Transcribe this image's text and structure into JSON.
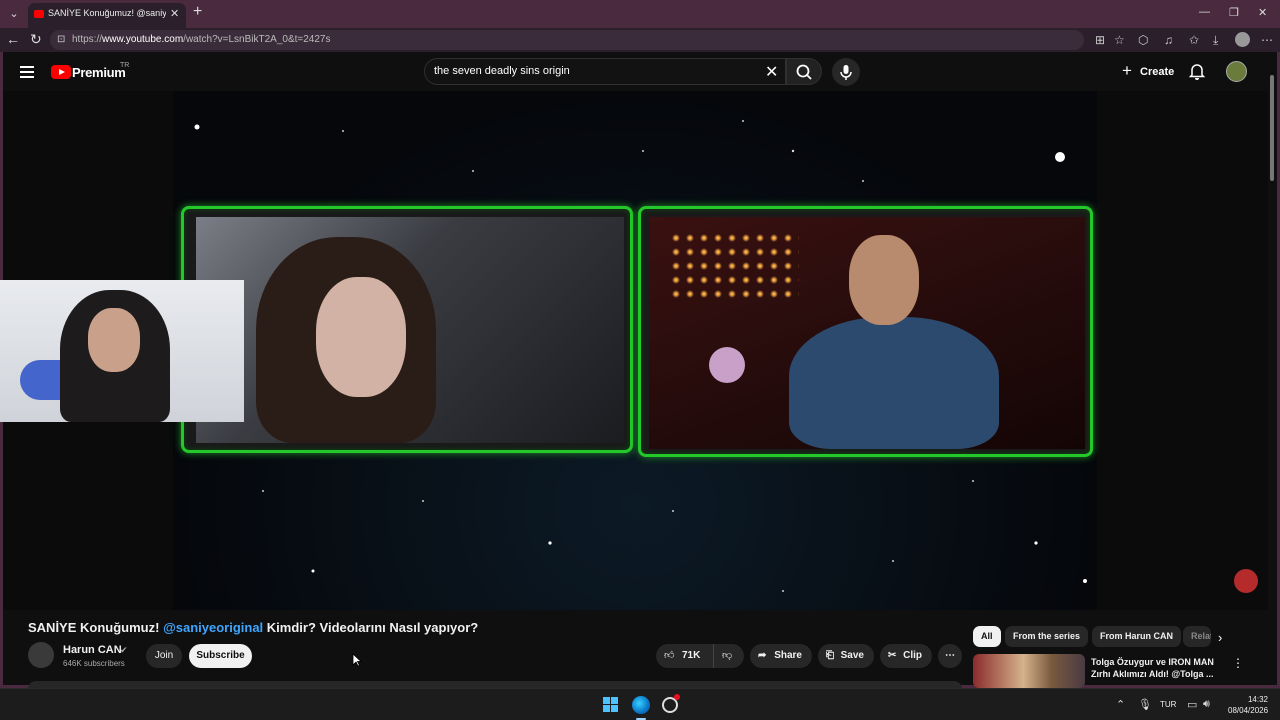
{
  "browser": {
    "tab_title": "SANİYE Konuğumuz! @saniyeoriginal",
    "url_prefix": "https://",
    "url_host": "www.youtube.com",
    "url_path": "/watch?v=LsnBikT2A_0&t=2427s"
  },
  "youtube": {
    "logo_text": "Premium",
    "region": "TR",
    "search_query": "the seven deadly sins origin",
    "create_label": "Create"
  },
  "video": {
    "title_prefix": "SANİYE Konuğumuz!",
    "title_mention": "@saniyeoriginal",
    "title_suffix": "Kimdir? Videolarını Nasıl yapıyor?"
  },
  "channel": {
    "name": "Harun CAN",
    "subscribers": "646K subscribers",
    "join_label": "Join",
    "subscribe_label": "Subscribe"
  },
  "actions": {
    "like_count": "71K",
    "share_label": "Share",
    "save_label": "Save",
    "clip_label": "Clip"
  },
  "chips": [
    "All",
    "From the series",
    "From Harun CAN",
    "Related"
  ],
  "recommendation": {
    "title": "Tolga Özuygur ve IRON MAN Zırhı Aklımızı Aldı! @Tolga ..."
  },
  "taskbar": {
    "language": "TUR",
    "time": "14:32",
    "date": "08/04/2026"
  },
  "colors": {
    "brand": "#ff0000",
    "link": "#3ea6ff",
    "frame_glow": "#24c82a",
    "browser_accent": "#4a2a3f"
  }
}
